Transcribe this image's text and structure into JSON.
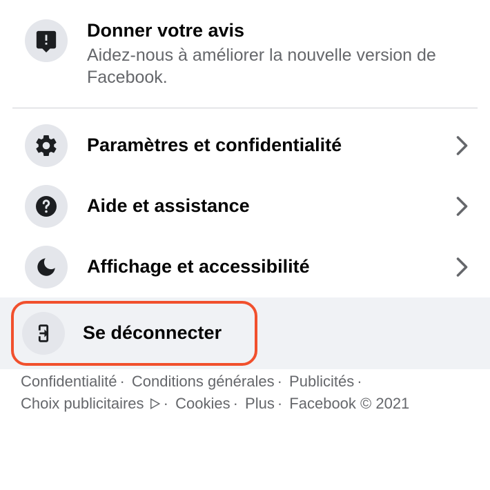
{
  "feedback": {
    "title": "Donner votre avis",
    "subtitle": "Aidez-nous à améliorer la nouvelle version de Facebook."
  },
  "items": {
    "settings": {
      "label": "Paramètres et confidentialité"
    },
    "help": {
      "label": "Aide et assistance"
    },
    "display": {
      "label": "Affichage et accessibilité"
    },
    "logout": {
      "label": "Se déconnecter"
    }
  },
  "footer": {
    "privacy": "Confidentialité",
    "terms": "Conditions générales",
    "ads": "Publicités",
    "adchoices": "Choix publicitaires",
    "cookies": "Cookies",
    "more": "Plus",
    "copyright": "Facebook © 2021"
  }
}
